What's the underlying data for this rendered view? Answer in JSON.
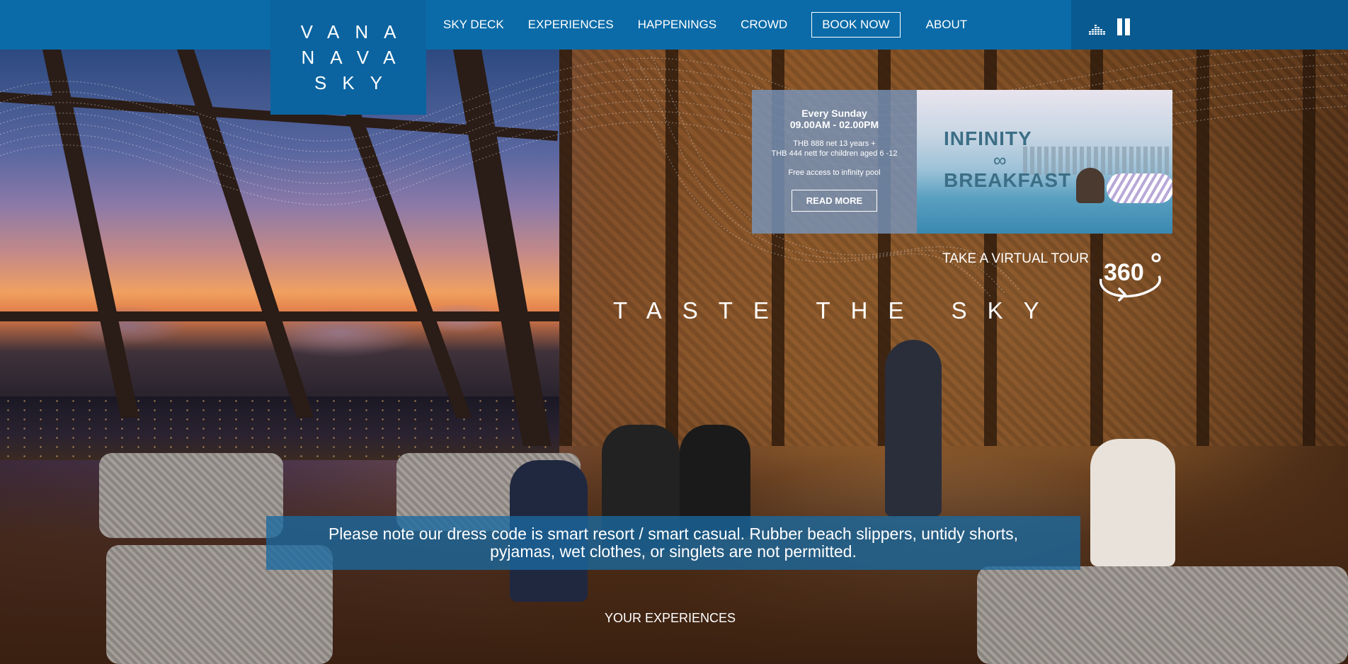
{
  "logo": {
    "line1": "VANA",
    "line2": "NAVA",
    "line3": "SKY"
  },
  "nav": {
    "items": [
      "SKY DECK",
      "EXPERIENCES",
      "HAPPENINGS",
      "CROWD"
    ],
    "book_now": "BOOK NOW",
    "about": "ABOUT"
  },
  "controls": {
    "audio_icon": "equalizer-icon",
    "pause_icon": "pause-icon"
  },
  "promo": {
    "day": "Every Sunday",
    "time": "09.00AM - 02.00PM",
    "price_adult": "THB 888 net 13 years +",
    "price_child": "THB 444 nett for children aged 6 -12",
    "pool": "Free access to infinity pool",
    "button": "READ MORE",
    "image_title_1": "INFINITY",
    "image_symbol": "∞",
    "image_title_2": "BREAKFAST"
  },
  "tour": {
    "label": "TAKE A VIRTUAL TOUR",
    "icon_text": "360",
    "icon": "360-tour-icon"
  },
  "headline": "TASTE THE SKY",
  "notice": {
    "line1": "Please note our dress code is smart resort / smart casual. Rubber beach slippers, untidy shorts,",
    "line2": "pyjamas, wet clothes, or singlets are not permitted."
  },
  "section_heading": "YOUR EXPERIENCES",
  "colors": {
    "header_bg": "#0b6ba8",
    "logo_bg": "#0b64a0",
    "notice_bg": "#1969a0"
  }
}
